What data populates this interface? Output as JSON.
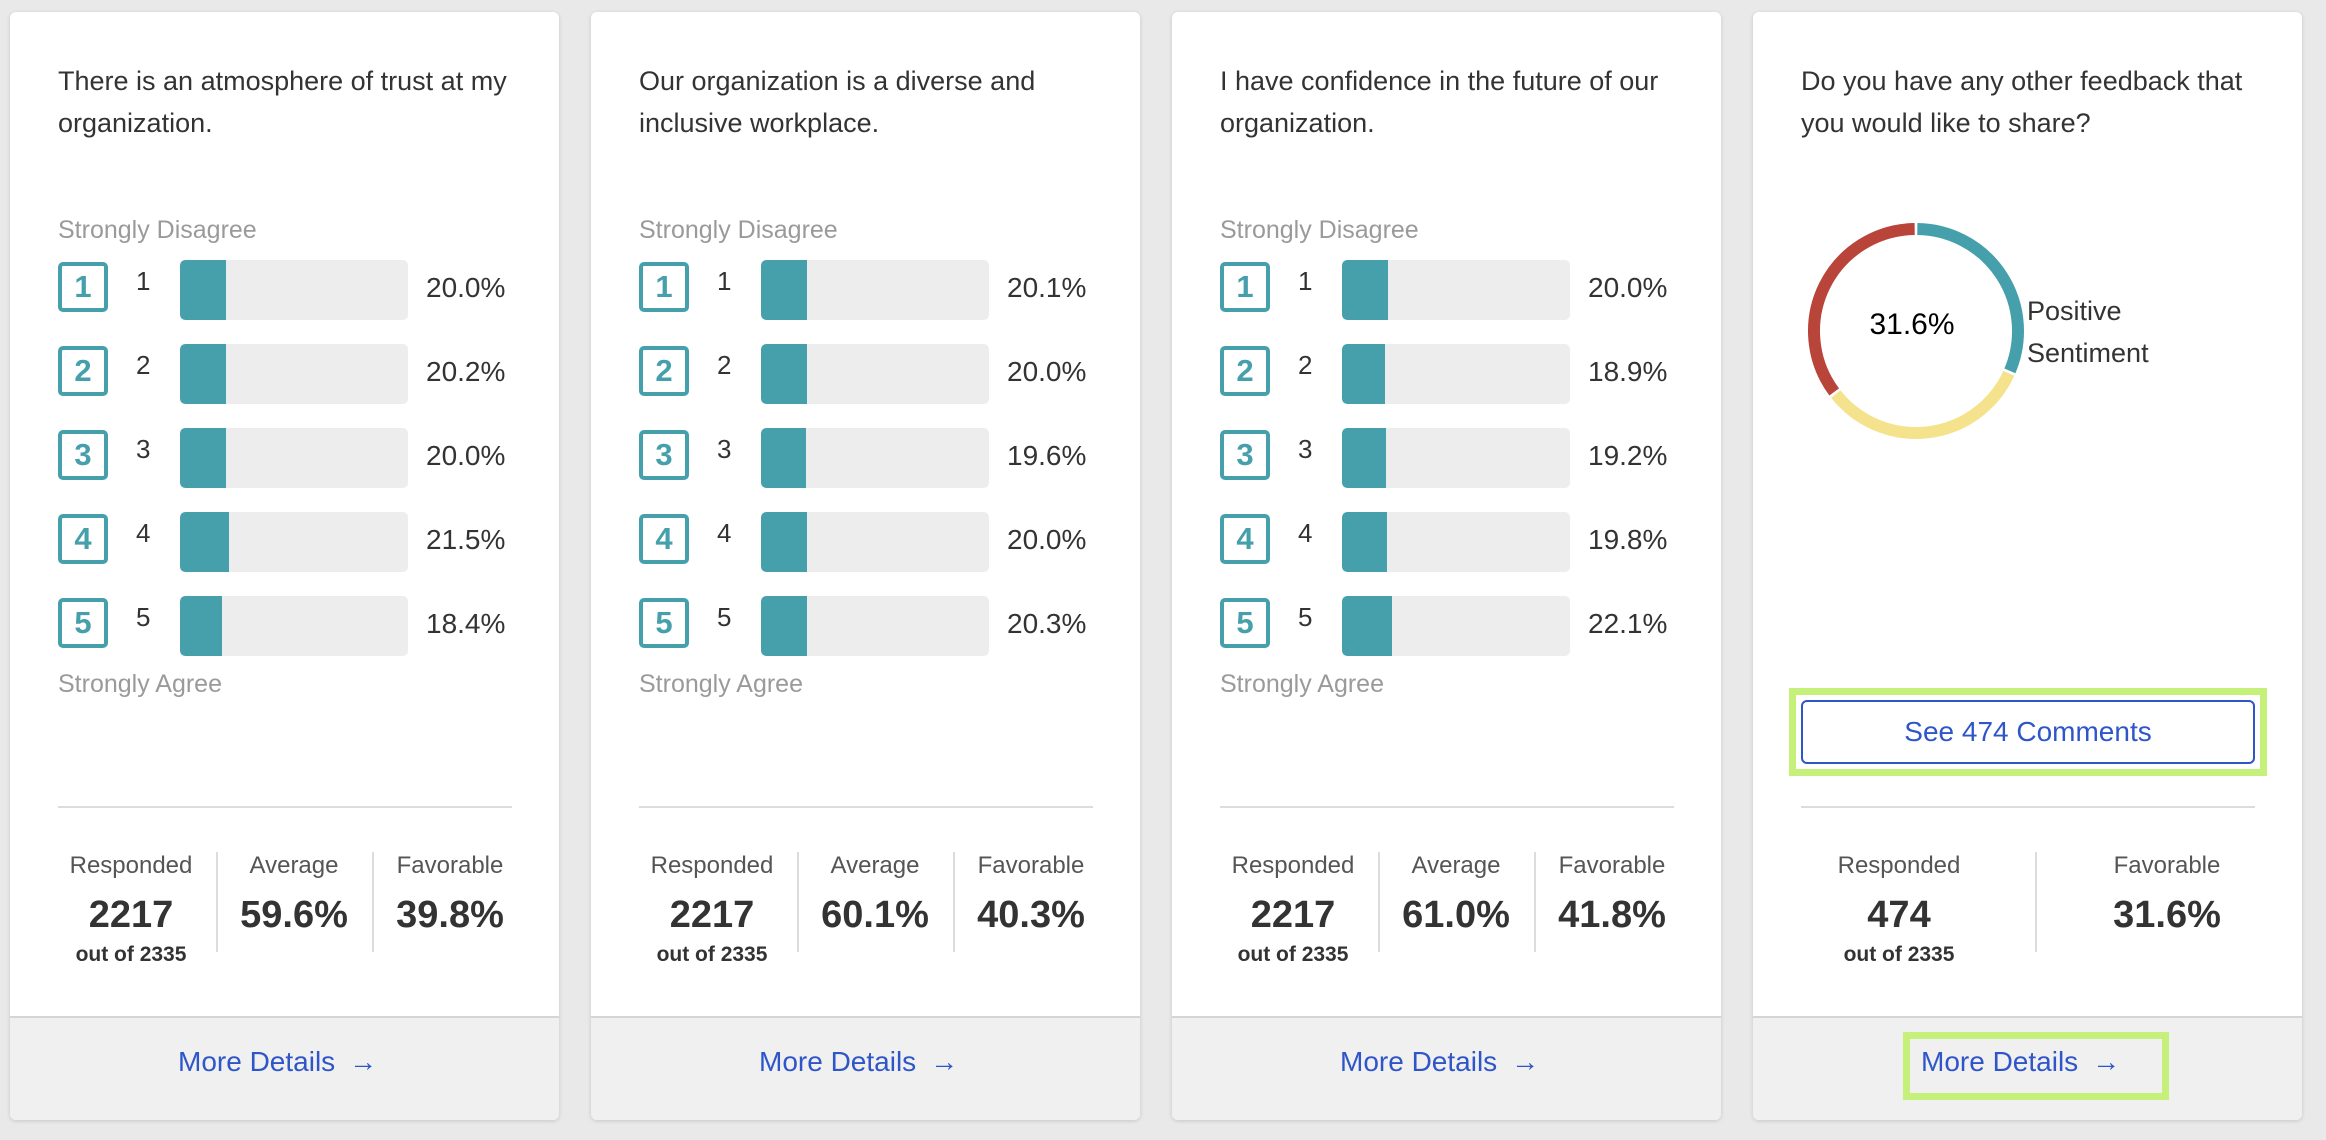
{
  "cards": [
    {
      "question": "There is an atmosphere of trust at my organization.",
      "scale_top": "Strongly Disagree",
      "scale_bottom": "Strongly Agree",
      "rows": [
        {
          "badge": "1",
          "num": "1",
          "pct": "20.0%",
          "value": 20.0
        },
        {
          "badge": "2",
          "num": "2",
          "pct": "20.2%",
          "value": 20.2
        },
        {
          "badge": "3",
          "num": "3",
          "pct": "20.0%",
          "value": 20.0
        },
        {
          "badge": "4",
          "num": "4",
          "pct": "21.5%",
          "value": 21.5
        },
        {
          "badge": "5",
          "num": "5",
          "pct": "18.4%",
          "value": 18.4
        }
      ],
      "stats": {
        "responded_label": "Responded",
        "responded_value": "2217",
        "responded_sub": "out of 2335",
        "average_label": "Average",
        "average_value": "59.6%",
        "favorable_label": "Favorable",
        "favorable_value": "39.8%"
      },
      "more_details": "More Details",
      "arrow": "→"
    },
    {
      "question": "Our organization is a diverse and inclusive workplace.",
      "scale_top": "Strongly Disagree",
      "scale_bottom": "Strongly Agree",
      "rows": [
        {
          "badge": "1",
          "num": "1",
          "pct": "20.1%",
          "value": 20.1
        },
        {
          "badge": "2",
          "num": "2",
          "pct": "20.0%",
          "value": 20.0
        },
        {
          "badge": "3",
          "num": "3",
          "pct": "19.6%",
          "value": 19.6
        },
        {
          "badge": "4",
          "num": "4",
          "pct": "20.0%",
          "value": 20.0
        },
        {
          "badge": "5",
          "num": "5",
          "pct": "20.3%",
          "value": 20.3
        }
      ],
      "stats": {
        "responded_label": "Responded",
        "responded_value": "2217",
        "responded_sub": "out of 2335",
        "average_label": "Average",
        "average_value": "60.1%",
        "favorable_label": "Favorable",
        "favorable_value": "40.3%"
      },
      "more_details": "More Details",
      "arrow": "→"
    },
    {
      "question": "I have confidence in the future of our organization.",
      "scale_top": "Strongly Disagree",
      "scale_bottom": "Strongly Agree",
      "rows": [
        {
          "badge": "1",
          "num": "1",
          "pct": "20.0%",
          "value": 20.0
        },
        {
          "badge": "2",
          "num": "2",
          "pct": "18.9%",
          "value": 18.9
        },
        {
          "badge": "3",
          "num": "3",
          "pct": "19.2%",
          "value": 19.2
        },
        {
          "badge": "4",
          "num": "4",
          "pct": "19.8%",
          "value": 19.8
        },
        {
          "badge": "5",
          "num": "5",
          "pct": "22.1%",
          "value": 22.1
        }
      ],
      "stats": {
        "responded_label": "Responded",
        "responded_value": "2217",
        "responded_sub": "out of 2335",
        "average_label": "Average",
        "average_value": "61.0%",
        "favorable_label": "Favorable",
        "favorable_value": "41.8%"
      },
      "more_details": "More Details",
      "arrow": "→"
    }
  ],
  "feedback_card": {
    "question": "Do you have any other feedback that you would like to share?",
    "donut_center": "31.6%",
    "donut_label": "Positive Sentiment",
    "sentiment": {
      "positive": 31.6,
      "neutral": 33.0,
      "negative": 35.4
    },
    "colors": {
      "positive": "#46a0ac",
      "neutral": "#f4e38c",
      "negative": "#b8443a"
    },
    "comments_button": "See 474 Comments",
    "stats": {
      "responded_label": "Responded",
      "responded_value": "474",
      "responded_sub": "out of 2335",
      "favorable_label": "Favorable",
      "favorable_value": "31.6%"
    },
    "more_details": "More Details",
    "arrow": "→"
  },
  "colors": {
    "accent": "#46a0ac",
    "link": "#2f56c8",
    "highlight": "#c5f07a"
  }
}
